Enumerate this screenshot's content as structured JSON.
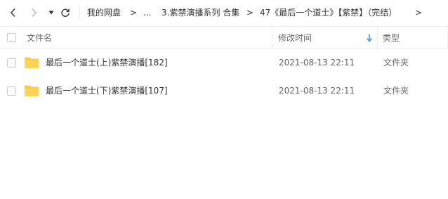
{
  "toolbar": {
    "breadcrumbs": [
      {
        "label": "我的网盘"
      },
      {
        "label": "..."
      },
      {
        "label": "3.紫禁演播系列 合集"
      },
      {
        "label": "47《最后一个道士》【紫禁】（完结）"
      }
    ],
    "separator": ">"
  },
  "columns": {
    "name": "文件名",
    "modified": "修改时间",
    "type": "类型"
  },
  "files": [
    {
      "name": "最后一个道士(上)紫禁演播[182]",
      "modified": "2021-08-13 22:11",
      "type": "文件夹",
      "icon": "folder-icon"
    },
    {
      "name": "最后一个道士(下)紫禁演播[107]",
      "modified": "2021-08-13 22:11",
      "type": "文件夹",
      "icon": "folder-icon"
    }
  ],
  "colors": {
    "folder": "#FFD25C",
    "sort_arrow": "#3B8CFF"
  }
}
